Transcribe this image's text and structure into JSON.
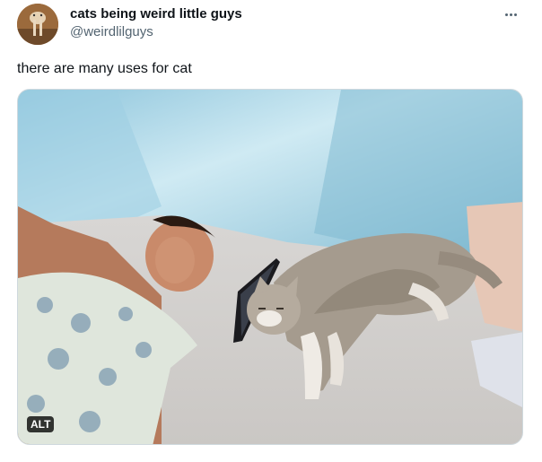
{
  "author": {
    "display_name": "cats being weird little guys",
    "handle": "@weirdlilguys"
  },
  "tweet": {
    "text": "there are many uses for cat"
  },
  "media": {
    "alt_badge": "ALT",
    "depicts": "photo"
  },
  "icons": {
    "more": "more-horizontal-icon"
  }
}
